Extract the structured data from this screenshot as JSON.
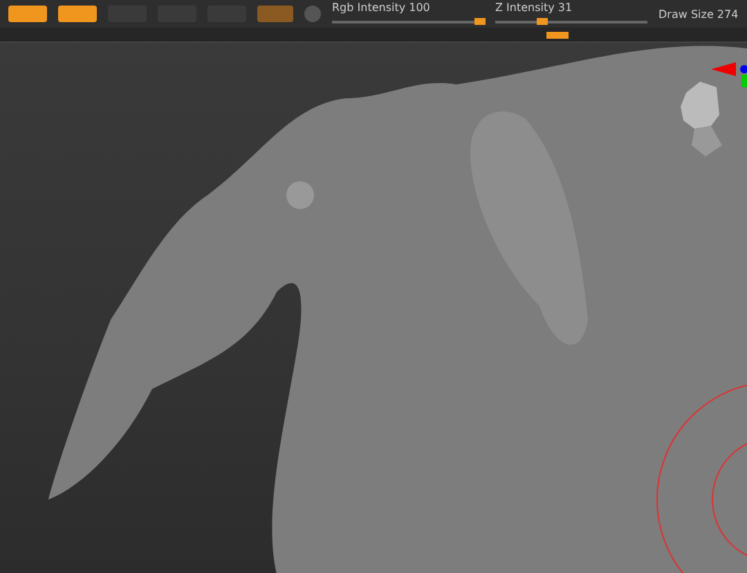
{
  "toolbar": {
    "mode_buttons": [
      {
        "selected": true
      },
      {
        "selected": true
      },
      {
        "selected": false
      },
      {
        "selected": false
      },
      {
        "selected": false
      }
    ],
    "sliders": [
      {
        "label": "Rgb Intensity 100",
        "level": 0.97
      },
      {
        "label": "Z Intensity 31",
        "level": 0.31
      }
    ],
    "draw_size": {
      "label": "Draw Size 274"
    }
  },
  "viewport": {
    "brush_cursor": true
  }
}
